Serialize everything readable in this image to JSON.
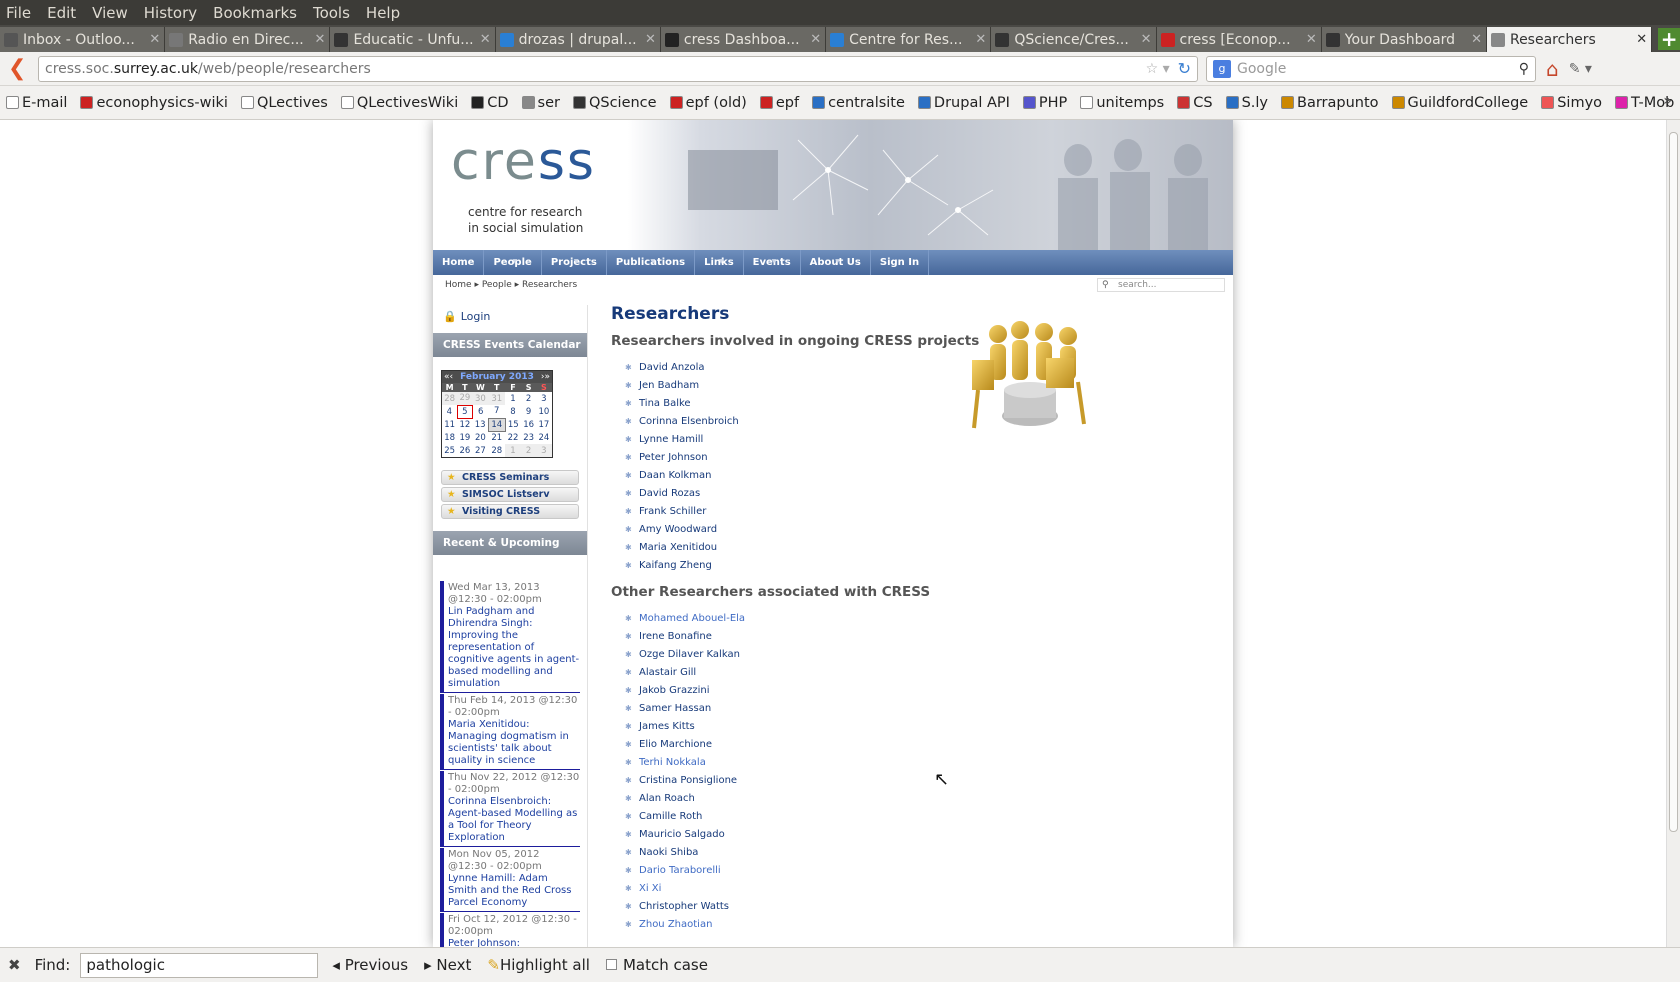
{
  "menu": [
    "File",
    "Edit",
    "View",
    "History",
    "Bookmarks",
    "Tools",
    "Help"
  ],
  "tabs": [
    {
      "label": "Inbox - Outloo...",
      "color": "#555555"
    },
    {
      "label": "Radio en Direc...",
      "color": "#777777"
    },
    {
      "label": "Educatic - Unfu...",
      "color": "#333333"
    },
    {
      "label": "drozas | drupal...",
      "color": "#2a7fd4"
    },
    {
      "label": "cress Dashboa...",
      "color": "#222222"
    },
    {
      "label": "Centre for Res...",
      "color": "#2a7fd4"
    },
    {
      "label": "QScience/Cres...",
      "color": "#333333"
    },
    {
      "label": "cress [Econop...",
      "color": "#cc2222"
    },
    {
      "label": "Your Dashboard",
      "color": "#333333"
    },
    {
      "label": "Researchers",
      "color": "#888888",
      "active": true
    }
  ],
  "url": {
    "prefix": "cress.soc.",
    "domain": "surrey.ac.uk",
    "path": "/web/people/researchers"
  },
  "search_placeholder": "Google",
  "bookmarks": [
    "E-mail",
    "econophysics-wiki",
    "QLectives",
    "QLectivesWiki",
    "CD",
    "ser",
    "QScience",
    "epf (old)",
    "epf",
    "centralsite",
    "Drupal API",
    "PHP",
    "unitemps",
    "CS",
    "S.ly",
    "Barrapunto",
    "GuildfordCollege",
    "Simyo",
    "T-Mob"
  ],
  "site": {
    "logo_a": "cre",
    "logo_b": "ss",
    "tagline1": "centre for research",
    "tagline2": "in social simulation",
    "nav": [
      "Home",
      "People",
      "Projects",
      "Publications",
      "Links",
      "Events",
      "About Us",
      "Sign In"
    ],
    "breadcrumb": [
      "Home",
      "People",
      "Researchers"
    ],
    "search_placeholder": "search...",
    "login": "Login",
    "calendar_title": "CRESS Events Calendar",
    "calendar_month": "February 2013",
    "calendar_days": [
      "M",
      "T",
      "W",
      "T",
      "F",
      "S",
      "S"
    ],
    "calendar_weeks": [
      [
        "28",
        "29",
        "30",
        "31",
        "1",
        "2",
        "3"
      ],
      [
        "4",
        "5",
        "6",
        "7",
        "8",
        "9",
        "10"
      ],
      [
        "11",
        "12",
        "13",
        "14",
        "15",
        "16",
        "17"
      ],
      [
        "18",
        "19",
        "20",
        "21",
        "22",
        "23",
        "24"
      ],
      [
        "25",
        "26",
        "27",
        "28",
        "1",
        "2",
        "3"
      ]
    ],
    "links": [
      "CRESS Seminars",
      "SIMSOC Listserv",
      "Visiting CRESS"
    ],
    "events_title": "Recent & Upcoming Events",
    "events": [
      {
        "date": "Wed Mar 13, 2013 @12:30 - 02:00pm",
        "title": "Lin Padgham and Dhirendra Singh: Improving the representation of cognitive agents in agent-based modelling and simulation"
      },
      {
        "date": "Thu Feb 14, 2013 @12:30 - 02:00pm",
        "title": "Maria Xenitidou: Managing dogmatism in scientists' talk about quality in science"
      },
      {
        "date": "Thu Nov 22, 2012 @12:30 - 02:00pm",
        "title": "Corinna Elsenbroich: Agent-based Modelling as a Tool for Theory Exploration"
      },
      {
        "date": "Mon Nov 05, 2012 @12:30 - 02:00pm",
        "title": "Lynne Hamill: Adam Smith and the Red Cross Parcel Economy"
      },
      {
        "date": "Fri Oct 12, 2012 @12:30 - 02:00pm",
        "title": "Peter Johnson: Understanding the use of models in environmental"
      }
    ],
    "page_title": "Researchers",
    "section1": "Researchers involved in ongoing CRESS projects",
    "researchers1": [
      "David Anzola",
      "Jen Badham",
      "Tina Balke",
      "Corinna Elsenbroich",
      "Lynne Hamill",
      "Peter Johnson",
      "Daan Kolkman",
      "David Rozas",
      "Frank Schiller",
      "Amy Woodward",
      "Maria Xenitidou",
      "Kaifang Zheng"
    ],
    "section2": "Other Researchers associated with CRESS",
    "researchers2": [
      "Mohamed Abouel-Ela",
      "Irene Bonafine",
      "Ozge Dilaver Kalkan",
      "Alastair Gill",
      "Jakob Grazzini",
      "Samer Hassan",
      "James Kitts",
      "Elio Marchione",
      "Terhi Nokkala",
      "Cristina Ponsiglione",
      "Alan Roach",
      "Camille Roth",
      "Mauricio Salgado",
      "Naoki Shiba",
      "Dario Taraborelli",
      "Xi Xi",
      "Christopher Watts",
      "Zhou Zhaotian"
    ]
  },
  "findbar": {
    "label": "Find:",
    "value": "pathologic",
    "previous": "Previous",
    "next": "Next",
    "highlight": "Highlight all",
    "match_case": "Match case"
  }
}
